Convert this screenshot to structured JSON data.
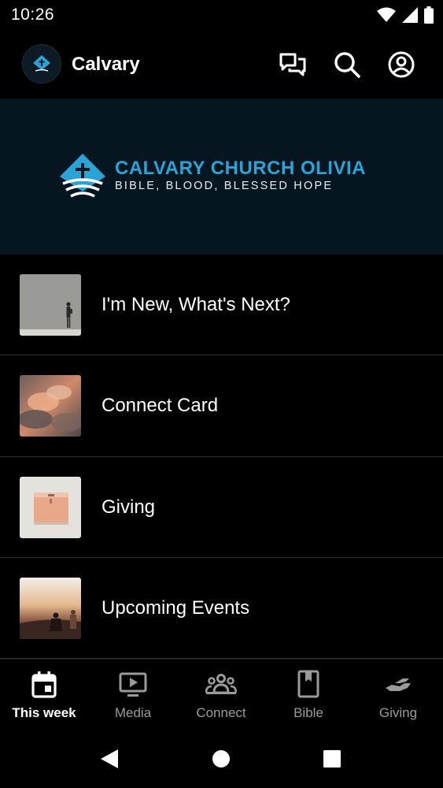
{
  "status_bar": {
    "time": "10:26",
    "icons": [
      "wifi-icon",
      "cellular-signal-icon",
      "battery-icon"
    ]
  },
  "app_bar": {
    "title": "Calvary",
    "logo_icon": "church-logo-icon",
    "actions": [
      "chat-icon",
      "search-icon",
      "account-icon"
    ]
  },
  "banner": {
    "name": "CALVARY CHURCH OLIVIA",
    "tagline": "BIBLE, BLOOD, BLESSED HOPE",
    "accent_color": "#2aa3d6",
    "background": "#061621"
  },
  "list": {
    "items": [
      {
        "label": "I'm New, What's Next?",
        "thumb": "person-by-wall-image"
      },
      {
        "label": "Connect Card",
        "thumb": "sunset-clouds-image"
      },
      {
        "label": "Giving",
        "thumb": "mailbox-image"
      },
      {
        "label": "Upcoming Events",
        "thumb": "people-at-sunset-image"
      }
    ]
  },
  "bottom_nav": {
    "active": "This week",
    "items": [
      {
        "label": "This week",
        "icon": "calendar-icon"
      },
      {
        "label": "Media",
        "icon": "video-icon"
      },
      {
        "label": "Connect",
        "icon": "group-icon"
      },
      {
        "label": "Bible",
        "icon": "book-icon"
      },
      {
        "label": "Giving",
        "icon": "hand-giving-icon"
      }
    ]
  },
  "system_nav": [
    "back-icon",
    "home-icon",
    "recents-icon"
  ]
}
